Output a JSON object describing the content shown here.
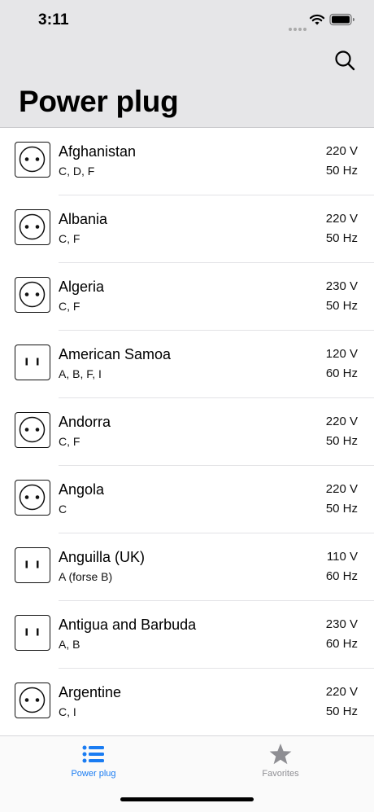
{
  "status": {
    "time": "3:11"
  },
  "header": {
    "title": "Power plug"
  },
  "countries": [
    {
      "name": "Afghanistan",
      "types": "C, D, F",
      "voltage": "220 V",
      "frequency": "50 Hz",
      "socket": "round"
    },
    {
      "name": "Albania",
      "types": "C, F",
      "voltage": "220 V",
      "frequency": "50 Hz",
      "socket": "round"
    },
    {
      "name": "Algeria",
      "types": "C, F",
      "voltage": "230 V",
      "frequency": "50 Hz",
      "socket": "round"
    },
    {
      "name": "American Samoa",
      "types": "A, B, F, I",
      "voltage": "120 V",
      "frequency": "60 Hz",
      "socket": "flat"
    },
    {
      "name": "Andorra",
      "types": "C, F",
      "voltage": "220 V",
      "frequency": "50 Hz",
      "socket": "round"
    },
    {
      "name": "Angola",
      "types": "C",
      "voltage": "220 V",
      "frequency": "50 Hz",
      "socket": "round"
    },
    {
      "name": "Anguilla (UK)",
      "types": "A (forse B)",
      "voltage": "110 V",
      "frequency": "60 Hz",
      "socket": "flat"
    },
    {
      "name": "Antigua and Barbuda",
      "types": "A, B",
      "voltage": "230 V",
      "frequency": "60 Hz",
      "socket": "flat"
    },
    {
      "name": "Argentine",
      "types": "C, I",
      "voltage": "220 V",
      "frequency": "50 Hz",
      "socket": "round"
    }
  ],
  "tabs": [
    {
      "label": "Power plug",
      "icon": "list-icon",
      "active": true
    },
    {
      "label": "Favorites",
      "icon": "star-icon",
      "active": false
    }
  ],
  "colors": {
    "accent": "#1a7cf2",
    "inactive": "#8e8e93",
    "header_bg": "#e6e6e8"
  }
}
